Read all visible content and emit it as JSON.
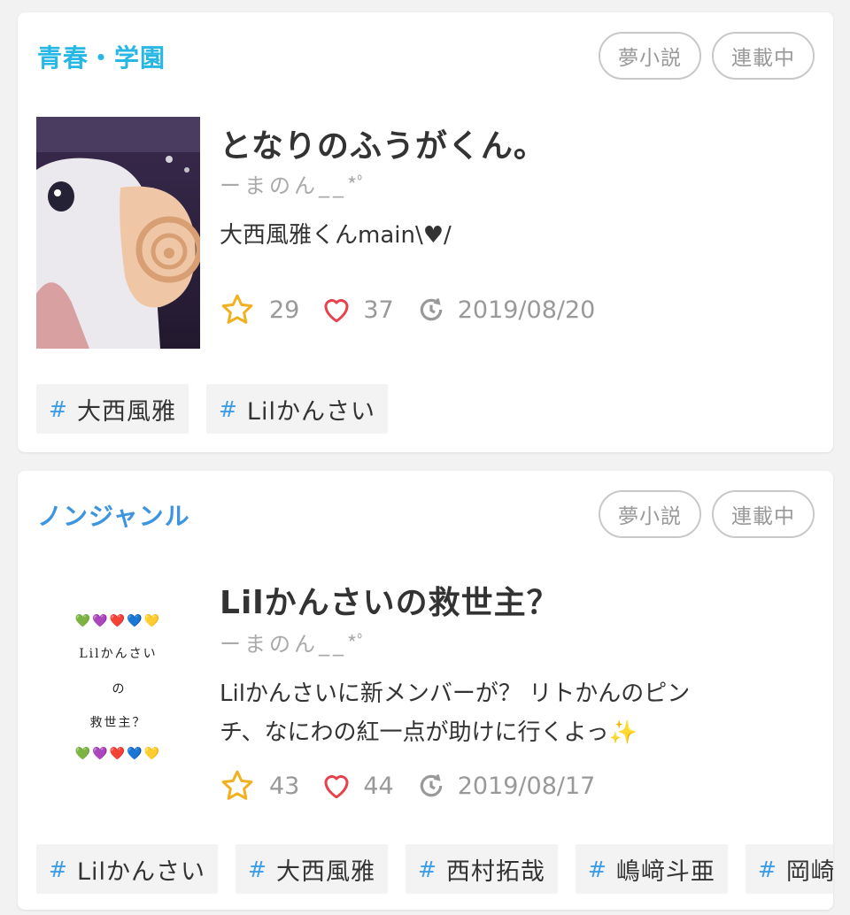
{
  "colors": {
    "genre_teal": "#27b7e4",
    "genre_blue": "#3d95e0",
    "hash_blue": "#3d9de8",
    "star_gold": "#f2b01e",
    "heart_red": "#e8414b",
    "meta_gray": "#999999"
  },
  "stories": [
    {
      "genre": "青春・学園",
      "badges": [
        "夢小説",
        "連載中"
      ],
      "title": "となりのふうがくん。",
      "author": "ーまのん__*ﾟ",
      "description": "大西風雅くんmain\\♥/",
      "stars": "29",
      "likes": "37",
      "updated": "2019/08/20",
      "tags": [
        "大西風雅",
        "Lilかんさい"
      ],
      "icons": [
        "star-icon",
        "heart-icon",
        "update-icon"
      ]
    },
    {
      "genre": "ノンジャンル",
      "badges": [
        "夢小説",
        "連載中"
      ],
      "title": "Lilかんさいの救世主？",
      "author": "ーまのん__*ﾟ",
      "description_line1": "Lilかんさいに新メンバーが？ リトかんのピン",
      "description_line2": "チ、なにわの紅一点が助けに行くよっ",
      "description_emoji": "✨",
      "cover_text": {
        "hearts": "💚💜❤️💙💛",
        "line1": "Lilかんさい",
        "line2": "の",
        "line3": "救世主？"
      },
      "stars": "43",
      "likes": "44",
      "updated": "2019/08/17",
      "tags": [
        "Lilかんさい",
        "大西風雅",
        "西村拓哉",
        "嶋﨑斗亜",
        "岡崎彪"
      ],
      "icons": [
        "star-icon",
        "heart-icon",
        "update-icon"
      ]
    }
  ]
}
